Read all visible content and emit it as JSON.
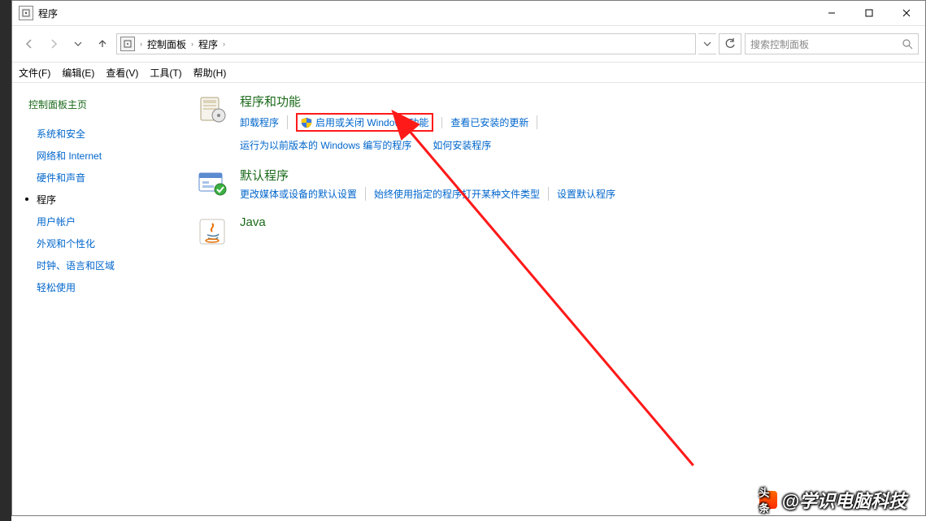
{
  "window": {
    "title": "程序"
  },
  "breadcrumb": {
    "root": "控制面板",
    "current": "程序"
  },
  "search": {
    "placeholder": "搜索控制面板"
  },
  "menubar": {
    "file": "文件(F)",
    "edit": "编辑(E)",
    "view": "查看(V)",
    "tools": "工具(T)",
    "help": "帮助(H)"
  },
  "sidebar": {
    "home": "控制面板主页",
    "items": [
      {
        "label": "系统和安全",
        "active": false
      },
      {
        "label": "网络和 Internet",
        "active": false
      },
      {
        "label": "硬件和声音",
        "active": false
      },
      {
        "label": "程序",
        "active": true
      },
      {
        "label": "用户帐户",
        "active": false
      },
      {
        "label": "外观和个性化",
        "active": false
      },
      {
        "label": "时钟、语言和区域",
        "active": false
      },
      {
        "label": "轻松使用",
        "active": false
      }
    ]
  },
  "groups": {
    "programs": {
      "heading": "程序和功能",
      "uninstall": "卸载程序",
      "features": "启用或关闭 Windows 功能",
      "updates": "查看已安装的更新",
      "compat": "运行为以前版本的 Windows 编写的程序",
      "howto": "如何安装程序"
    },
    "default": {
      "heading": "默认程序",
      "media": "更改媒体或设备的默认设置",
      "filetype": "始终使用指定的程序打开某种文件类型",
      "setdefault": "设置默认程序"
    },
    "java": {
      "heading": "Java"
    }
  },
  "watermark": {
    "badge": "头条",
    "text": "@学识电脑科技"
  }
}
